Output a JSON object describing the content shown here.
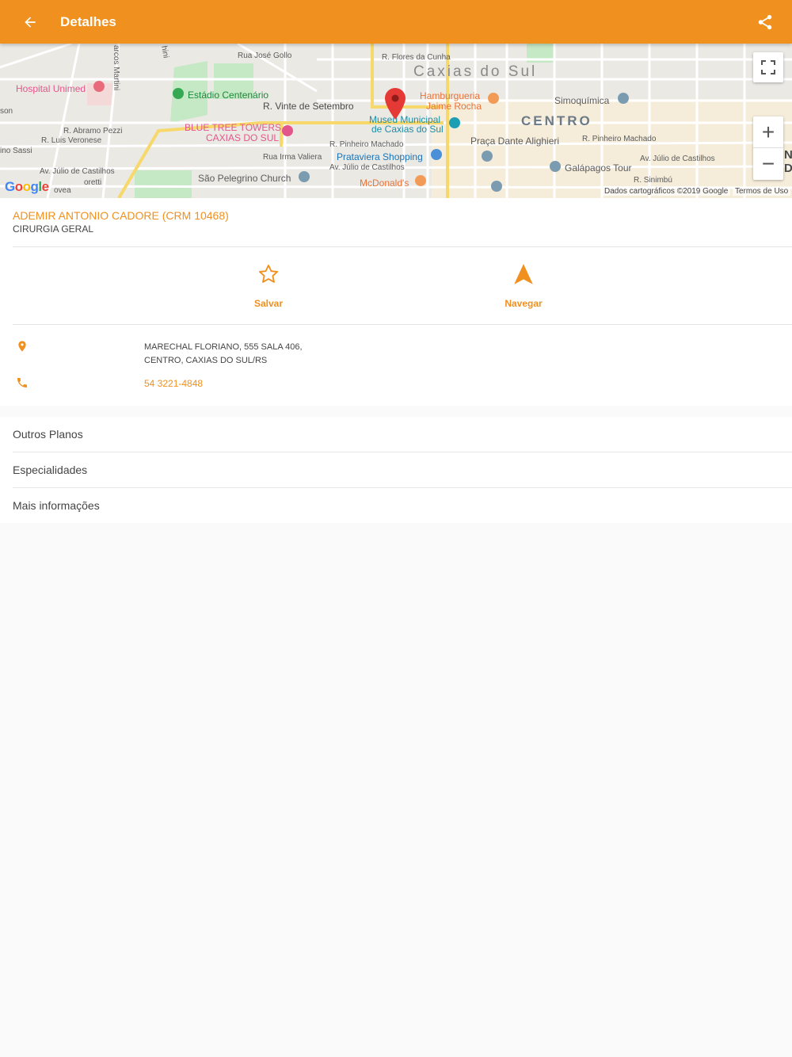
{
  "appbar": {
    "title": "Detalhes",
    "back_icon": "arrow-back-icon",
    "share_icon": "share-icon",
    "color": "#f0901e"
  },
  "map": {
    "labels": {
      "rua_jose_gollo": "Rua José Gollo",
      "r_flores_da_cunha": "R. Flores da Cunha",
      "caxias_do_sul": "Caxias do Sul",
      "hospital_unimed": "Hospital Unimed",
      "estadio": "Estádio Centenário",
      "vinte_setembro": "R. Vinte de Setembro",
      "hamburgueria_1": "Hamburgueria",
      "hamburgueria_2": "Jaime Rocha",
      "simoquimica": "Simoquímica",
      "abramo_pezzi": "R. Abramo Pezzi",
      "blue_tree_1": "BLUE TREE TOWERS",
      "blue_tree_2": "CAXIAS DO SUL",
      "museu_1": "Museu Municipal",
      "museu_2": "de Caxias do Sul",
      "centro": "CENTRO",
      "luis_veronese": "R. Luis Veronese",
      "pinheiro_machado": "R. Pinheiro Machado",
      "praca_dante": "Praça Dante Alighieri",
      "pinheiro_machado_2": "R. Pinheiro Machado",
      "sassi": "ino Sassi",
      "irma_valiera": "Rua Irma Valiera",
      "prataviera": "Prataviera Shopping",
      "julio_castilhos_right": "Av. Júlio de Castilhos",
      "julio_castilhos_mid": "Av. Júlio de Castilhos",
      "julio_castilhos_left": "Av. Júlio de Castilhos",
      "galapagos": "Galápagos Tour",
      "sao_pelegrino": "São Pelegrino Church",
      "mcdonalds": "McDonald's",
      "r_sinimbu": "R. Sinimbú",
      "marcos_martini": "arcos Martini",
      "hini": "hini",
      "son": "son",
      "ovea": "ovea",
      "oretti": "oretti",
      "edge_n": "N",
      "edge_d": "D"
    },
    "google_logo": "Google",
    "credit": "Dados cartográficos ©2019 Google",
    "terms": "Termos de Uso",
    "zoom_in": "+",
    "zoom_out": "−",
    "fullscreen_icon": "fullscreen-icon"
  },
  "doctor": {
    "name": "ADEMIR ANTONIO CADORE (CRM 10468)",
    "specialty": "CIRURGIA GERAL"
  },
  "actions": [
    {
      "label": "Salvar",
      "icon": "star-outline-icon"
    },
    {
      "label": "Navegar",
      "icon": "navigation-icon"
    }
  ],
  "address": {
    "line1": "MARECHAL FLORIANO, 555 SALA 406,",
    "line2": "CENTRO, CAXIAS DO SUL/RS",
    "icon": "location-pin-icon"
  },
  "phone": {
    "number": "54 3221-4848",
    "icon": "phone-icon"
  },
  "list": [
    {
      "label": "Outros Planos"
    },
    {
      "label": "Especialidades"
    },
    {
      "label": "Mais informações"
    }
  ]
}
